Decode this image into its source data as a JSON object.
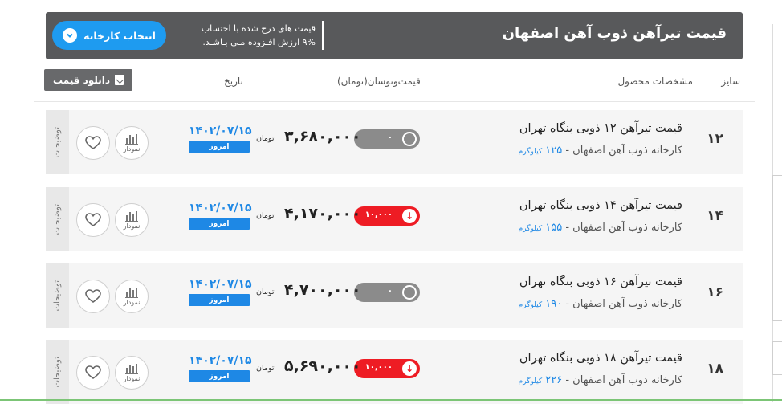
{
  "header": {
    "title": "قیمت تیرآهن ذوب آهن اصفهان",
    "note_line1": "قیمت های درج شده با احتساب",
    "note_line2": "۹% ارزش افـزوده مـی بـاشـد.",
    "factory_button": "انتخاب کارخانه"
  },
  "columns": {
    "size": "سایز",
    "spec": "مشخصات محصول",
    "price": "قیمت‌ونوسان(تومان)",
    "date": "تاریخ",
    "download": "دانلود قیمت"
  },
  "rows": [
    {
      "size": "۱۲",
      "title": "قیمت تیرآهن ۱۲ ذوبی بنگاه تهران",
      "subtitle": "کارخانه ذوب آهن اصفهان -",
      "weight": "۱۲۵",
      "unit": "کیلوگرم",
      "change": "۰",
      "change_type": "neutral",
      "price": "۳,۶۸۰,۰۰۰",
      "currency": "تومان",
      "date": "۱۴۰۲/۰۷/۱۵",
      "today": "امروز",
      "chart_label": "نمودار",
      "side_label": "توضیحات"
    },
    {
      "size": "۱۴",
      "title": "قیمت تیرآهن ۱۴ ذوبی بنگاه تهران",
      "subtitle": "کارخانه ذوب آهن اصفهان -",
      "weight": "۱۵۵",
      "unit": "کیلوگرم",
      "change": "۱۰,۰۰۰",
      "change_type": "down",
      "price": "۴,۱۷۰,۰۰۰",
      "currency": "تومان",
      "date": "۱۴۰۲/۰۷/۱۵",
      "today": "امروز",
      "chart_label": "نمودار",
      "side_label": "توضیحات"
    },
    {
      "size": "۱۶",
      "title": "قیمت تیرآهن ۱۶ ذوبی بنگاه تهران",
      "subtitle": "کارخانه ذوب آهن اصفهان -",
      "weight": "۱۹۰",
      "unit": "کیلوگرم",
      "change": "۰",
      "change_type": "neutral",
      "price": "۴,۷۰۰,۰۰۰",
      "currency": "تومان",
      "date": "۱۴۰۲/۰۷/۱۵",
      "today": "امروز",
      "chart_label": "نمودار",
      "side_label": "توضیحات"
    },
    {
      "size": "۱۸",
      "title": "قیمت تیرآهن ۱۸ ذوبی بنگاه تهران",
      "subtitle": "کارخانه ذوب آهن اصفهان -",
      "weight": "۲۲۶",
      "unit": "کیلوگرم",
      "change": "۱۰,۰۰۰",
      "change_type": "down",
      "price": "۵,۶۹۰,۰۰۰",
      "currency": "تومان",
      "date": "۱۴۰۲/۰۷/۱۵",
      "today": "امروز",
      "chart_label": "نمودار",
      "side_label": "توضیحات"
    }
  ],
  "icons": {
    "factory_chevron": "chevron-down-icon",
    "download": "download-icon",
    "neutral_change": "circle-icon",
    "down_change": "arrow-down-icon",
    "chart": "bar-chart-icon",
    "favorite": "heart-icon"
  },
  "colors": {
    "header_bg": "#58595b",
    "accent_blue": "#1e9bf0",
    "down_red": "#ee1c24",
    "neutral_gray": "#8b8b8b",
    "date_blue": "#1e88e5"
  }
}
